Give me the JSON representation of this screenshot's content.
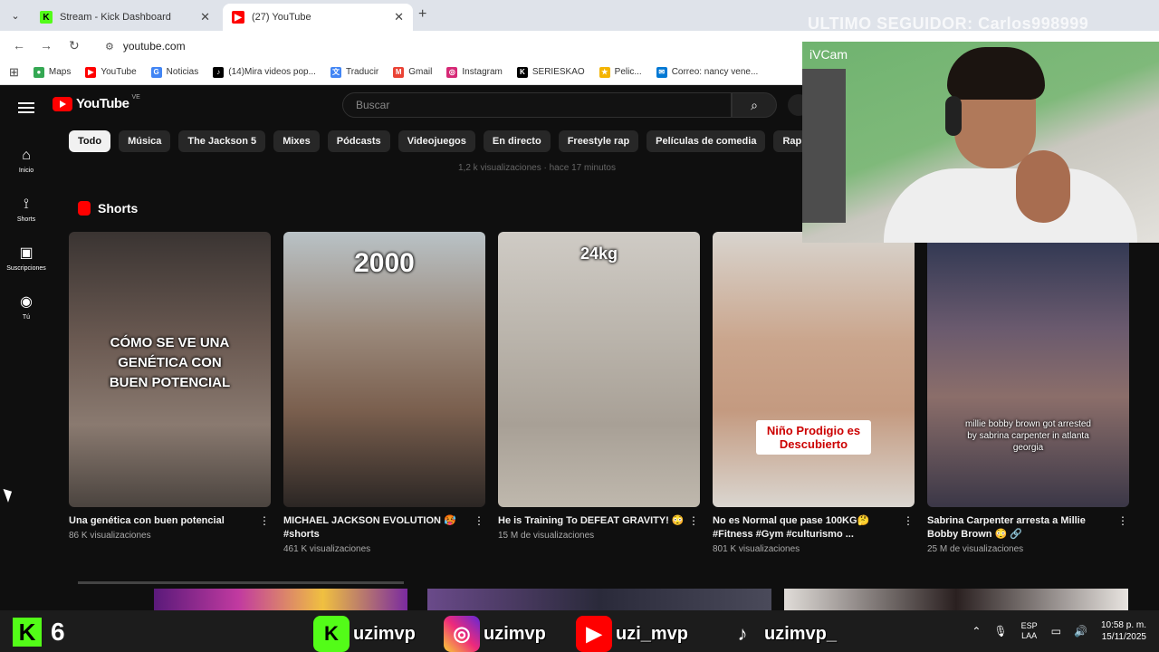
{
  "browser": {
    "tabs": [
      {
        "title": "Stream - Kick Dashboard",
        "active": false
      },
      {
        "title": "(27) YouTube",
        "active": true
      }
    ],
    "url": "youtube.com",
    "bookmarks": [
      "Maps",
      "YouTube",
      "Noticias",
      "(14)Mira videos pop...",
      "Traducir",
      "Gmail",
      "Instagram",
      "SERIESKAO",
      "Pelic...",
      "Correo: nancy vene..."
    ]
  },
  "youtube": {
    "logo_text": "YouTube",
    "country": "VE",
    "search_placeholder": "Buscar",
    "sidebar": [
      {
        "label": "Inicio",
        "icon": "home-icon"
      },
      {
        "label": "Shorts",
        "icon": "shorts-icon"
      },
      {
        "label": "Suscripciones",
        "icon": "subscriptions-icon"
      },
      {
        "label": "Tú",
        "icon": "you-icon"
      }
    ],
    "chips": [
      "Todo",
      "Música",
      "The Jackson 5",
      "Mixes",
      "Pódcasts",
      "Videojuegos",
      "En directo",
      "Freestyle rap",
      "Películas de comedia",
      "Rap"
    ],
    "selected_chip": "Todo",
    "blurred_meta": "1,2 k visualizaciones · hace 17 minutos",
    "shorts_title": "Shorts",
    "shorts": [
      {
        "title": "Una genética con buen potencial",
        "views": "86 K visualizaciones",
        "overlay": "CÓMO SE VE UNA GENÉTICA CON BUEN POTENCIAL"
      },
      {
        "title": "MICHAEL JACKSON EVOLUTION 🥵 #shorts",
        "views": "461 K visualizaciones",
        "overlay": "2000"
      },
      {
        "title": "He is Training To DEFEAT GRAVITY! 😳",
        "views": "15 M de visualizaciones",
        "overlay": "24kg"
      },
      {
        "title": "No es Normal que pase 100KG🤔 #Fitness #Gym #culturismo ...",
        "views": "801 K visualizaciones",
        "overlay": "Niño Prodigio es Descubierto"
      },
      {
        "title": "Sabrina Carpenter arresta a Millie Bobby Brown 😳 🔗",
        "views": "25 M de visualizaciones",
        "overlay": "millie bobby brown got arrested by sabrina carpenter in atlanta georgia"
      }
    ]
  },
  "webcam": {
    "title": "iVCam"
  },
  "stream_overlay": "ULTIMO SEGUIDOR: Carlos998999",
  "taskbar": {
    "kick_count": "6",
    "socials": [
      {
        "platform": "Kick",
        "handle": "uzimvp"
      },
      {
        "platform": "Instagram",
        "handle": "uzimvp"
      },
      {
        "platform": "YouTube",
        "handle": "uzi_mvp"
      },
      {
        "platform": "TikTok",
        "handle": "uzimvp_"
      }
    ],
    "lang_top": "ESP",
    "lang_bottom": "LAA",
    "time": "10:58 p. m.",
    "date": "15/11/2025"
  },
  "colors": {
    "youtube_red": "#ff0000",
    "kick_green": "#53fc18",
    "yt_bg": "#0f0f0f"
  }
}
